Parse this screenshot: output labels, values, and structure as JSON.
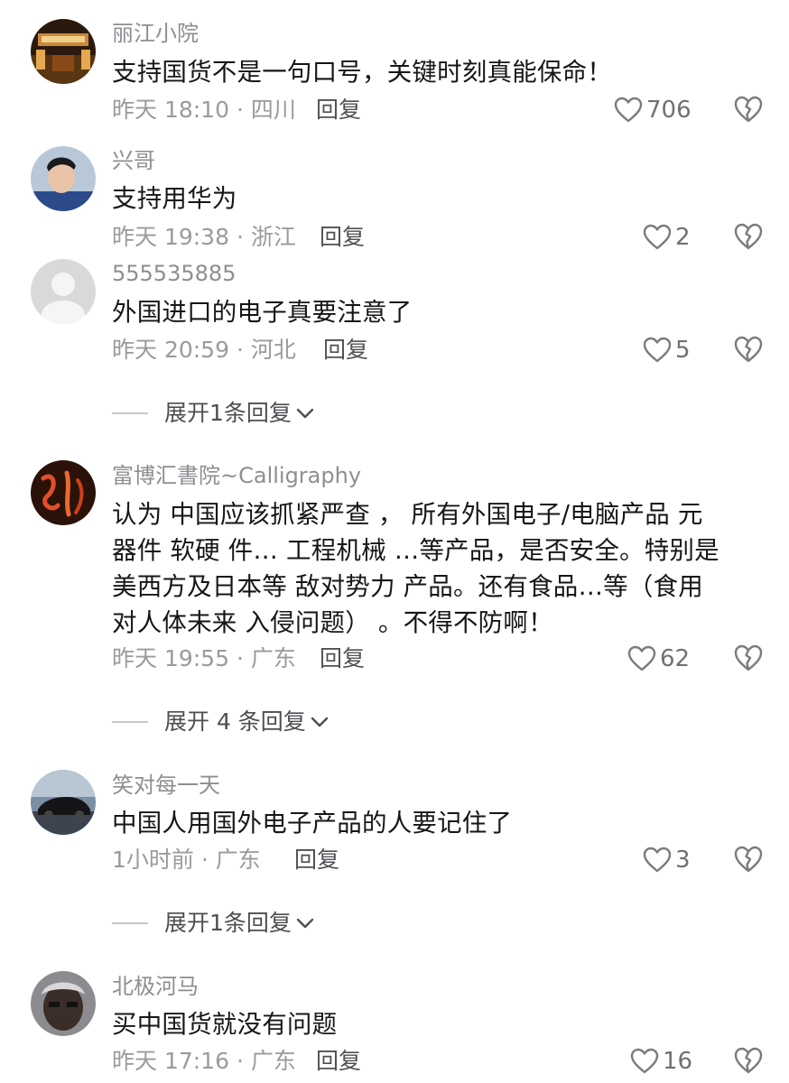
{
  "comments": [
    {
      "username": "丽江小院",
      "text": [
        "支持国货不是一句口号，关键时刻真能保命！"
      ],
      "time_location": "昨天 18:10 · 四川",
      "reply_label": "回复",
      "likes": "706"
    },
    {
      "username": "兴哥",
      "text": [
        "支持用华为"
      ],
      "time_location": "昨天 19:38 · 浙江",
      "reply_label": "回复",
      "likes": "2"
    },
    {
      "username": "555535885",
      "text": [
        "外国进口的电子真要注意了"
      ],
      "time_location": "昨天 20:59 · 河北",
      "reply_label": "回复",
      "likes": "5",
      "expand_label": "展开1条回复"
    },
    {
      "username": "富博汇書院~Calligraphy",
      "text": [
        "认为 中国应该抓紧严查 ， 所有外国电子/电脑产品  元",
        "器件 软硬 件… 工程机械 …等产品，是否安全。特别是",
        "美西方及日本等 敌对势力 产品。还有食品…等（食用",
        "对人体未来 入侵问题）  。不得不防啊！"
      ],
      "time_location": "昨天 19:55 · 广东",
      "reply_label": "回复",
      "likes": "62",
      "expand_label": "展开 4 条回复"
    },
    {
      "username": "笑对每一天",
      "text": [
        "中国人用国外电子产品的人要记住了"
      ],
      "time_location": "1小时前 · 广东",
      "reply_label": "回复",
      "likes": "3",
      "expand_label": "展开1条回复"
    },
    {
      "username": "北极河马",
      "text": [
        "买中国货就没有问题"
      ],
      "time_location": "昨天 17:16 · 广东",
      "reply_label": "回复",
      "likes": "16"
    }
  ],
  "icons": {
    "like": "heart-outline-icon",
    "dislike": "broken-heart-icon",
    "expand": "chevron-down-icon"
  },
  "colors": {
    "username": "#8e8e93",
    "text": "#161616",
    "meta": "#9a9a9f",
    "reply": "#505055",
    "icon": "#7a7a7f"
  }
}
